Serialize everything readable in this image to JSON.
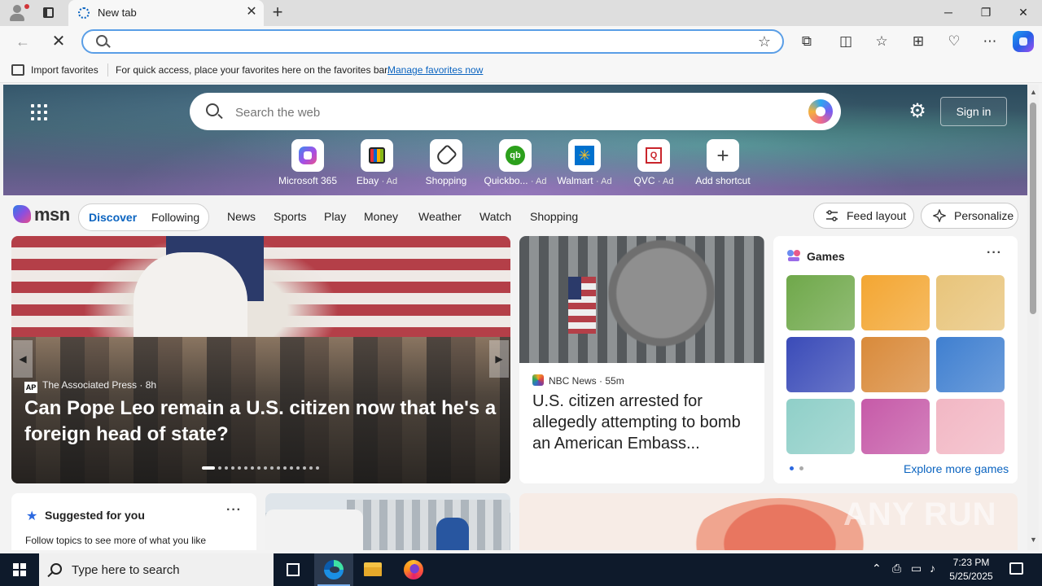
{
  "browser": {
    "tab_title": "New tab",
    "address_value": "",
    "favbar": {
      "import_label": "Import favorites",
      "hint": "For quick access, place your favorites here on the favorites bar.",
      "link": "Manage favorites now"
    }
  },
  "newtab": {
    "search_placeholder": "Search the web",
    "signin_label": "Sign in",
    "shortcuts": [
      {
        "label": "Microsoft 365",
        "ad": ""
      },
      {
        "label": "Ebay",
        "ad": "· Ad"
      },
      {
        "label": "Shopping",
        "ad": ""
      },
      {
        "label": "Quickbo...",
        "ad": "· Ad"
      },
      {
        "label": "Walmart",
        "ad": "· Ad"
      },
      {
        "label": "QVC",
        "ad": "· Ad"
      },
      {
        "label": "Add shortcut",
        "ad": ""
      }
    ],
    "msn": {
      "logo_text": "msn",
      "tabs": [
        "Discover",
        "Following"
      ],
      "nav": [
        "News",
        "Sports",
        "Play",
        "Money",
        "Weather",
        "Watch",
        "Shopping"
      ],
      "feed_layout_label": "Feed layout",
      "personalize_label": "Personalize"
    },
    "hero": {
      "source": "The Associated Press",
      "source_logo": "AP",
      "age": "8h",
      "title": "Can Pope Leo remain a U.S. citizen now that he's a foreign head of state?"
    },
    "news": {
      "source": "NBC News",
      "age": "55m",
      "title": "U.S. citizen arrested for allegedly attempting to bomb an American Embass..."
    },
    "games": {
      "title": "Games",
      "explore": "Explore more games",
      "tiles": [
        {
          "color": "#6fa84a"
        },
        {
          "color": "#f3a632"
        },
        {
          "color": "#e8c47a"
        },
        {
          "color": "#3a4bb8"
        },
        {
          "color": "#d98a3a"
        },
        {
          "color": "#3f7fd0"
        },
        {
          "color": "#8fcfc8"
        },
        {
          "color": "#c65aa8"
        },
        {
          "color": "#f2b7c4"
        }
      ]
    },
    "suggested": {
      "title": "Suggested for you",
      "text": "Follow topics to see more of what you like"
    }
  },
  "watermark": "ANY RUN",
  "taskbar": {
    "search_placeholder": "Type here to search",
    "time": "7:23 PM",
    "date": "5/25/2025"
  }
}
